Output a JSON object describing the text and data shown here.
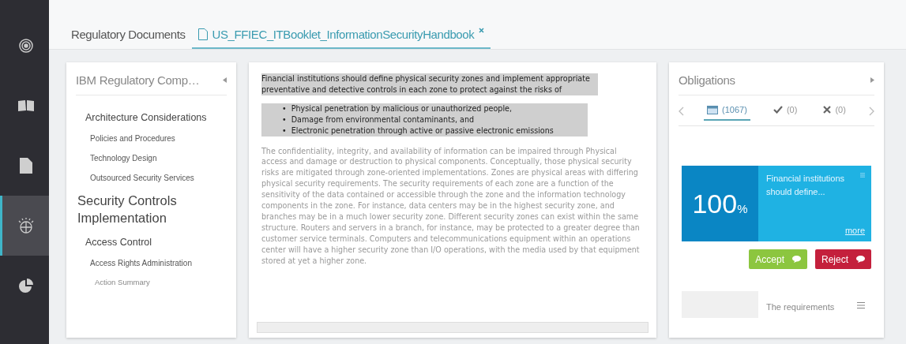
{
  "sidebar": {
    "items": [
      {
        "kind": "target",
        "selected": false
      },
      {
        "kind": "book",
        "selected": false
      },
      {
        "kind": "document",
        "selected": false
      },
      {
        "kind": "globe",
        "selected": true
      },
      {
        "kind": "pie",
        "selected": false
      }
    ]
  },
  "tabs": [
    {
      "label": "Regulatory Documents",
      "selected": false,
      "kind": "plain"
    },
    {
      "label": "US_FFIEC_ITBooklet_InformationSecurityHandbook",
      "selected": true,
      "kind": "document"
    }
  ],
  "toc": {
    "title": "IBM Regulatory Comp…",
    "items": [
      {
        "label": "Architecture Considerations",
        "kind": "section",
        "children": [
          {
            "label": "Policies and Procedures",
            "kind": "topic"
          },
          {
            "label": "Technology Design",
            "kind": "topic"
          },
          {
            "label": "Outsourced Security Services",
            "kind": "topic"
          }
        ]
      },
      {
        "label": "Security Controls Implementation",
        "kind": "chapter",
        "children": [
          {
            "label": "Access Control",
            "kind": "section",
            "children": [
              {
                "label": "Access Rights Administration",
                "kind": "topic",
                "children": [
                  {
                    "label": "Action Summary",
                    "kind": "minor"
                  }
                ]
              }
            ]
          }
        ]
      }
    ]
  },
  "document": {
    "highlight": "Financial institutions should define physical security zones and implement appropriate preventative and detective controls in each zone to protect against the risks of",
    "marker": "•",
    "bullets": [
      "Physical penetration by malicious or unauthorized people,",
      "Damage from environmental contaminants, and",
      "Electronic penetration through active or passive electronic emissions"
    ],
    "paragraph": "The confidentiality, integrity, and availability of information can be impaired through Physical access and damage or destruction to physical components. Conceptually, those physical security risks are mitigated through zone-oriented implementations. Zones are physical areas with differing physical security requirements. The security requirements of each zone are a function of the sensitivity of the data contained or accessible through the zone and the information technology components in the zone. For instance, data centers may be in the highest security zone, and branches may be in a much lower security zone. Different security zones can exist within the same structure. Routers and servers in a branch, for instance, may be protected to a greater degree than customer service terminals. Computers and telecommunications equipment within an operations center will have a higher security zone than I/O operations, with the media used by that equipment stored at yet a higher zone."
  },
  "obligations": {
    "title": "Obligations",
    "filters": [
      {
        "kind": "all",
        "label": "(1067)",
        "selected": true
      },
      {
        "kind": "accepted",
        "label": "(0)",
        "selected": false
      },
      {
        "kind": "rejected",
        "label": "(0)",
        "selected": false
      }
    ],
    "cards": [
      {
        "score": "100",
        "unit": "%",
        "text": "Financial institutions should define...",
        "more": "more",
        "accept": "Accept",
        "reject": "Reject"
      },
      {
        "text": "The requirements"
      }
    ]
  }
}
